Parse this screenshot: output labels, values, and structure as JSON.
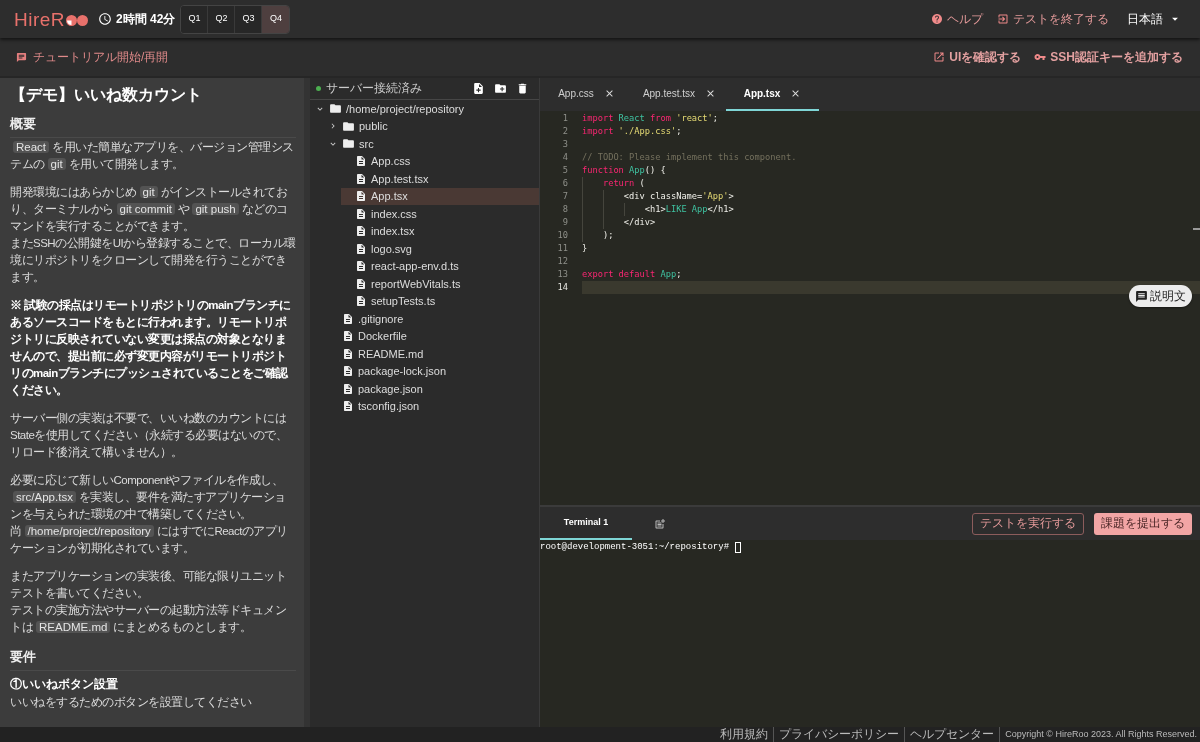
{
  "header": {
    "logo": "HireR",
    "timer": "2時間 42分",
    "questions": [
      {
        "label": "Q1",
        "selected": false
      },
      {
        "label": "Q2",
        "selected": false
      },
      {
        "label": "Q3",
        "selected": false
      },
      {
        "label": "Q4",
        "selected": true
      }
    ],
    "help": "ヘルプ",
    "end_test": "テストを終了する",
    "language": "日本語"
  },
  "toolbar": {
    "tutorial": "チュートリアル開始/再開",
    "actions": [
      {
        "kind": "open-ui",
        "label": "UIを確認する"
      },
      {
        "kind": "ssh-key",
        "label": "SSH認証キーを追加する"
      }
    ]
  },
  "problem": {
    "title": "【デモ】いいね数カウント",
    "sections": [
      {
        "heading": "概要",
        "blocks": [
          {
            "kind": "paragraph",
            "bold": false,
            "lines": [
              [
                {
                  "kind": "code",
                  "text": "React"
                },
                {
                  "kind": "text",
                  "text": "を用いた簡単なアプリを、バージョン管理システムの"
                },
                {
                  "kind": "code",
                  "text": "git"
                },
                {
                  "kind": "text",
                  "text": "を用いて開発します。"
                }
              ]
            ]
          },
          {
            "kind": "paragraph",
            "bold": false,
            "lines": [
              [
                {
                  "kind": "text",
                  "text": "開発環境にはあらかじめ"
                },
                {
                  "kind": "code",
                  "text": "git"
                },
                {
                  "kind": "text",
                  "text": "がインストールされており、ターミナルから"
                },
                {
                  "kind": "code",
                  "text": "git commit"
                },
                {
                  "kind": "text",
                  "text": "や"
                },
                {
                  "kind": "code",
                  "text": "git push"
                },
                {
                  "kind": "text",
                  "text": "などのコマンドを実行することができます。"
                }
              ],
              [
                {
                  "kind": "text",
                  "text": "またSSHの公開鍵をUIから登録することで、ローカル環境にリポジトリをクローンして開発を行うことができます。"
                }
              ]
            ]
          },
          {
            "kind": "paragraph",
            "bold": true,
            "lines": [
              [
                {
                  "kind": "text",
                  "text": "※ 試験の採点はリモートリポジトリのmainブランチにあるソースコードをもとに行われます。リモートリポジトリに反映されていない変更は採点の対象となりませんので、提出前に必ず変更内容がリモートリポジトリのmainブランチにプッシュされていることをご確認ください。"
                }
              ]
            ]
          },
          {
            "kind": "paragraph",
            "bold": false,
            "lines": [
              [
                {
                  "kind": "text",
                  "text": "サーバー側の実装は不要で、いいね数のカウントにはStateを使用してください（永続する必要はないので、リロード後消えて構いません）。"
                }
              ]
            ]
          },
          {
            "kind": "paragraph",
            "bold": false,
            "lines": [
              [
                {
                  "kind": "text",
                  "text": "必要に応じて新しいComponentやファイルを作成し、"
                },
                {
                  "kind": "code",
                  "text": "src/App.tsx"
                },
                {
                  "kind": "text",
                  "text": "を実装し、要件を満たすアプリケーションを与えられた環境の中で構築してください。"
                }
              ],
              [
                {
                  "kind": "text",
                  "text": "尚"
                },
                {
                  "kind": "code",
                  "text": "/home/project/repository"
                },
                {
                  "kind": "text",
                  "text": "にはすでにReactのアプリケーションが初期化されています。"
                }
              ]
            ]
          },
          {
            "kind": "paragraph",
            "bold": false,
            "lines": [
              [
                {
                  "kind": "text",
                  "text": "またアプリケーションの実装後、可能な限りユニットテストを書いてください。"
                }
              ],
              [
                {
                  "kind": "text",
                  "text": "テストの実施方法やサーバーの起動方法等ドキュメントは"
                },
                {
                  "kind": "code",
                  "text": "README.md"
                },
                {
                  "kind": "text",
                  "text": "にまとめるものとします。"
                }
              ]
            ]
          }
        ]
      },
      {
        "heading": "要件",
        "blocks": [
          {
            "kind": "subheading",
            "text": "①いいねボタン設置"
          },
          {
            "kind": "paragraph",
            "bold": false,
            "lines": [
              [
                {
                  "kind": "text",
                  "text": "いいねをするためのボタンを設置してください"
                }
              ]
            ]
          }
        ]
      }
    ]
  },
  "explorer": {
    "status": "サーバー接続済み",
    "connected": true,
    "tree": [
      {
        "name": "/home/project/repository",
        "kind": "folder",
        "expanded": true,
        "selected": false,
        "children": [
          {
            "name": "public",
            "kind": "folder",
            "expanded": false,
            "selected": false
          },
          {
            "name": "src",
            "kind": "folder",
            "expanded": true,
            "selected": false,
            "children": [
              {
                "name": "App.css",
                "kind": "file",
                "selected": false
              },
              {
                "name": "App.test.tsx",
                "kind": "file",
                "selected": false
              },
              {
                "name": "App.tsx",
                "kind": "file",
                "selected": true
              },
              {
                "name": "index.css",
                "kind": "file",
                "selected": false
              },
              {
                "name": "index.tsx",
                "kind": "file",
                "selected": false
              },
              {
                "name": "logo.svg",
                "kind": "file",
                "selected": false
              },
              {
                "name": "react-app-env.d.ts",
                "kind": "file",
                "selected": false
              },
              {
                "name": "reportWebVitals.ts",
                "kind": "file",
                "selected": false
              },
              {
                "name": "setupTests.ts",
                "kind": "file",
                "selected": false
              }
            ]
          },
          {
            "name": ".gitignore",
            "kind": "file",
            "selected": false
          },
          {
            "name": "Dockerfile",
            "kind": "file",
            "selected": false
          },
          {
            "name": "README.md",
            "kind": "file",
            "selected": false
          },
          {
            "name": "package-lock.json",
            "kind": "file",
            "selected": false
          },
          {
            "name": "package.json",
            "kind": "file",
            "selected": false
          },
          {
            "name": "tsconfig.json",
            "kind": "file",
            "selected": false
          }
        ]
      }
    ]
  },
  "editor": {
    "tabs": [
      {
        "label": "App.css",
        "selected": false
      },
      {
        "label": "App.test.tsx",
        "selected": false
      },
      {
        "label": "App.tsx",
        "selected": true
      }
    ],
    "lines": [
      {
        "number": "1",
        "current": false,
        "tokens": [
          {
            "kind": "keyword",
            "text": "import"
          },
          {
            "kind": "ident",
            "text": " React"
          },
          {
            "kind": "keyword",
            "text": " from"
          },
          {
            "kind": "string",
            "text": " 'react'"
          },
          {
            "kind": "plain",
            "text": ";"
          }
        ]
      },
      {
        "number": "2",
        "current": false,
        "tokens": [
          {
            "kind": "keyword",
            "text": "import"
          },
          {
            "kind": "string",
            "text": " './App.css'"
          },
          {
            "kind": "plain",
            "text": ";"
          }
        ]
      },
      {
        "number": "3",
        "current": false
      },
      {
        "number": "4",
        "current": false,
        "tokens": [
          {
            "kind": "comment",
            "text": "// TODO: Please implement this component."
          }
        ]
      },
      {
        "number": "5",
        "current": false,
        "tokens": [
          {
            "kind": "keyword",
            "text": "function"
          },
          {
            "kind": "ident",
            "text": " App"
          },
          {
            "kind": "plain",
            "text": "() {"
          }
        ]
      },
      {
        "number": "6",
        "current": false,
        "tokens": [
          {
            "kind": "keyword",
            "text": "    return"
          },
          {
            "kind": "plain",
            "text": " ("
          }
        ]
      },
      {
        "number": "7",
        "current": false,
        "tokens": [
          {
            "kind": "plain",
            "text": "        <div className="
          },
          {
            "kind": "string",
            "text": "'App'"
          },
          {
            "kind": "plain",
            "text": ">"
          }
        ]
      },
      {
        "number": "8",
        "current": false,
        "tokens": [
          {
            "kind": "plain",
            "text": "            <h1>"
          },
          {
            "kind": "ident",
            "text": "LIKE App"
          },
          {
            "kind": "plain",
            "text": "</h1>"
          }
        ]
      },
      {
        "number": "9",
        "current": false,
        "tokens": [
          {
            "kind": "plain",
            "text": "        </div>"
          }
        ]
      },
      {
        "number": "10",
        "current": false,
        "tokens": [
          {
            "kind": "plain",
            "text": "    );"
          }
        ]
      },
      {
        "number": "11",
        "current": false,
        "tokens": [
          {
            "kind": "plain",
            "text": "}"
          }
        ]
      },
      {
        "number": "12",
        "current": false
      },
      {
        "number": "13",
        "current": false,
        "tokens": [
          {
            "kind": "keyword",
            "text": "export"
          },
          {
            "kind": "keyword",
            "text": " default"
          },
          {
            "kind": "ident",
            "text": " App"
          },
          {
            "kind": "plain",
            "text": ";"
          }
        ]
      },
      {
        "number": "14",
        "current": true
      }
    ],
    "description_button": "説明文"
  },
  "terminal": {
    "tabs": [
      {
        "label": "Terminal 1",
        "selected": true
      }
    ],
    "buttons": [
      {
        "kind": "outline",
        "label": "テストを実行する"
      },
      {
        "kind": "primary",
        "label": "課題を提出する"
      }
    ],
    "prompt": "root@development-3051:~/repository#"
  },
  "footer": {
    "links": [
      "利用規約",
      "プライバシーポリシー",
      "ヘルプセンター"
    ],
    "copyright": "Copyright © HireRoo 2023. All Rights Reserved."
  }
}
